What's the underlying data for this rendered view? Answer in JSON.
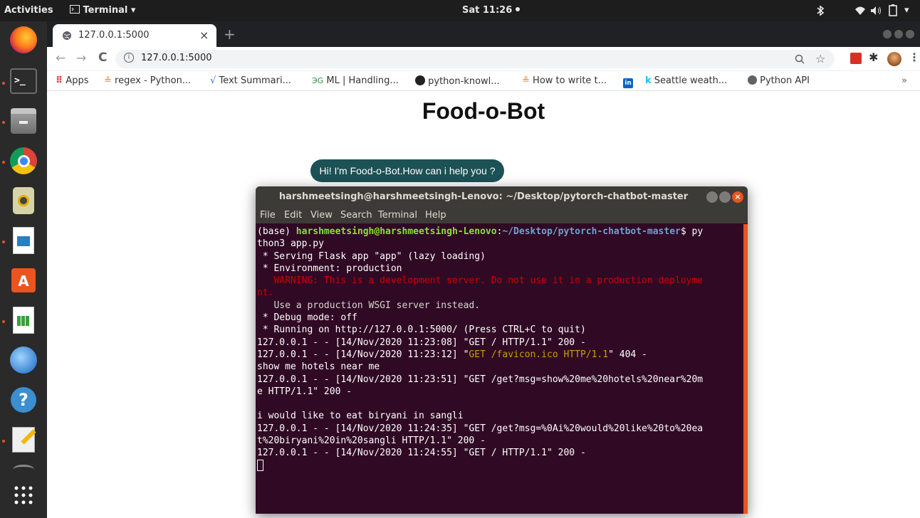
{
  "topbar": {
    "activities": "Activities",
    "app_name": "Terminal",
    "clock": "Sat 11:26",
    "dropdown_glyph": "▾"
  },
  "dock": {
    "items": [
      {
        "name": "firefox-icon",
        "running": false
      },
      {
        "name": "terminal-icon",
        "running": true
      },
      {
        "name": "files-icon",
        "running": true
      },
      {
        "name": "chrome-icon",
        "running": true
      },
      {
        "name": "speaker-app-icon",
        "running": false
      },
      {
        "name": "impress-icon",
        "running": true
      },
      {
        "name": "software-center-icon",
        "running": false
      },
      {
        "name": "calc-icon",
        "running": true
      },
      {
        "name": "thunderbird-icon",
        "running": false
      },
      {
        "name": "help-icon",
        "running": false
      },
      {
        "name": "text-editor-icon",
        "running": true
      },
      {
        "name": "show-apps-icon",
        "running": false
      }
    ]
  },
  "browser": {
    "tab_title": "127.0.0.1:5000",
    "tab_close": "×",
    "new_tab": "+",
    "url": "127.0.0.1:5000",
    "bookmarks": [
      {
        "label": "Apps",
        "icon": "apps-grid-icon"
      },
      {
        "label": "regex - Python...",
        "icon": "stackoverflow-icon"
      },
      {
        "label": "Text Summari...",
        "icon": "chart-icon"
      },
      {
        "label": "ML | Handling...",
        "icon": "gfg-icon"
      },
      {
        "label": "python-knowl...",
        "icon": "github-icon"
      },
      {
        "label": "How to write t...",
        "icon": "stackoverflow-icon"
      },
      {
        "label": "",
        "icon": "linkedin-icon"
      },
      {
        "label": "Seattle weath...",
        "icon": "kaggle-icon"
      },
      {
        "label": "Python API",
        "icon": "globe-icon"
      }
    ],
    "bookmarks_overflow": "»"
  },
  "page": {
    "title": "Food-o-Bot",
    "bot_message": "Hi! I'm Food-o-Bot.How can i help you ?"
  },
  "terminal": {
    "title": "harshmeetsingh@harshmeetsingh-Lenovo: ~/Desktop/pytorch-chatbot-master",
    "menu": [
      "File",
      "Edit",
      "View",
      "Search",
      "Terminal",
      "Help"
    ],
    "prompt_env": "(base) ",
    "prompt_user": "harshmeetsingh@harshmeetsingh-Lenovo",
    "prompt_colon": ":",
    "prompt_path": "~/Desktop/pytorch-chatbot-master",
    "prompt_cmd": "$ py",
    "lines": {
      "l2": "thon3 app.py",
      "l3": " * Serving Flask app \"app\" (lazy loading)",
      "l4": " * Environment: production",
      "l5": "   WARNING: This is a development server. Do not use it in a production deployme",
      "l6": "nt.",
      "l7": "   Use a production WSGI server instead.",
      "l8": " * Debug mode: off",
      "l9": " * Running on http://127.0.0.1:5000/ (Press CTRL+C to quit)",
      "l10": "127.0.0.1 - - [14/Nov/2020 11:23:08] \"GET / HTTP/1.1\" 200 -",
      "l11a": "127.0.0.1 - - [14/Nov/2020 11:23:12] \"",
      "l11b": "GET /favicon.ico HTTP/1.1",
      "l11c": "\" 404 -",
      "l12": "show me hotels near me",
      "l13": "127.0.0.1 - - [14/Nov/2020 11:23:51] \"GET /get?msg=show%20me%20hotels%20near%20m",
      "l14": "e HTTP/1.1\" 200 -",
      "l15": "",
      "l16": "i would like to eat biryani in sangli",
      "l17": "127.0.0.1 - - [14/Nov/2020 11:24:35] \"GET /get?msg=%0Ai%20would%20like%20to%20ea",
      "l18": "t%20biryani%20in%20sangli HTTP/1.1\" 200 -",
      "l19": "127.0.0.1 - - [14/Nov/2020 11:24:55] \"GET / HTTP/1.1\" 200 -"
    }
  },
  "colors": {
    "terminal_bg": "#300a24",
    "ubuntu_orange": "#e95420",
    "bubble_bg": "#1c5155",
    "prompt_green": "#8ae234",
    "prompt_blue": "#729fcf",
    "warning_red": "#cc0000"
  }
}
